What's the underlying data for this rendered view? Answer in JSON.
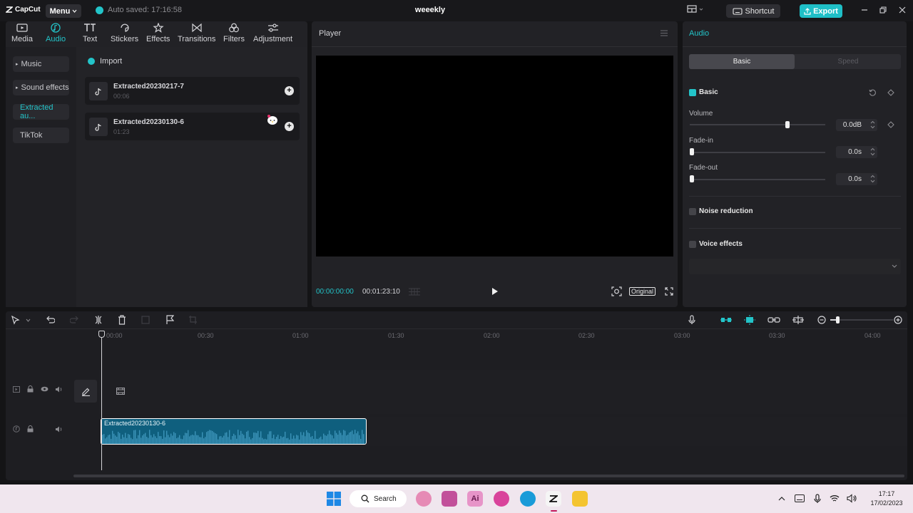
{
  "app": {
    "logo": "CapCut",
    "menu_label": "Menu",
    "autosave": "Auto saved: 17:16:58",
    "project_title": "weeekly",
    "shortcut_label": "Shortcut",
    "export_label": "Export"
  },
  "toolbar": {
    "items": [
      {
        "label": "Media",
        "icon": "media-icon"
      },
      {
        "label": "Audio",
        "icon": "audio-icon",
        "active": true
      },
      {
        "label": "Text",
        "icon": "text-icon"
      },
      {
        "label": "Stickers",
        "icon": "stickers-icon"
      },
      {
        "label": "Effects",
        "icon": "effects-icon"
      },
      {
        "label": "Transitions",
        "icon": "transitions-icon"
      },
      {
        "label": "Filters",
        "icon": "filters-icon"
      },
      {
        "label": "Adjustment",
        "icon": "adjustment-icon"
      }
    ]
  },
  "sidebar": {
    "items": [
      {
        "label": "Music"
      },
      {
        "label": "Sound effects"
      },
      {
        "label": "Extracted au...",
        "active": true
      },
      {
        "label": "TikTok"
      }
    ]
  },
  "library": {
    "import_label": "Import",
    "items": [
      {
        "name": "Extracted20230217-7",
        "duration": "00:06"
      },
      {
        "name": "Extracted20230130-6",
        "duration": "01:23"
      }
    ]
  },
  "player": {
    "title": "Player",
    "current_time": "00:00:00:00",
    "total_time": "00:01:23:10",
    "ratio_label": "Original"
  },
  "inspector": {
    "title": "Audio",
    "tabs": [
      "Basic",
      "Speed"
    ],
    "active_tab": "Basic",
    "basic_label": "Basic",
    "volume_label": "Volume",
    "volume_value": "0.0dB",
    "volume_level": 0.72,
    "fadein_label": "Fade-in",
    "fadein_value": "0.0s",
    "fadeout_label": "Fade-out",
    "fadeout_value": "0.0s",
    "noise_label": "Noise reduction",
    "voice_label": "Voice effects"
  },
  "timeline": {
    "ruler": [
      "00:00",
      "00:30",
      "01:00",
      "01:30",
      "02:00",
      "02:30",
      "03:00",
      "03:30",
      "04:00"
    ],
    "clip_name": "Extracted20230130-6"
  },
  "taskbar": {
    "search_label": "Search",
    "time": "17:17",
    "date": "17/02/2023"
  },
  "colors": {
    "accent": "#23c4c9",
    "clip": "#0f5f7e",
    "background": "#141416"
  }
}
